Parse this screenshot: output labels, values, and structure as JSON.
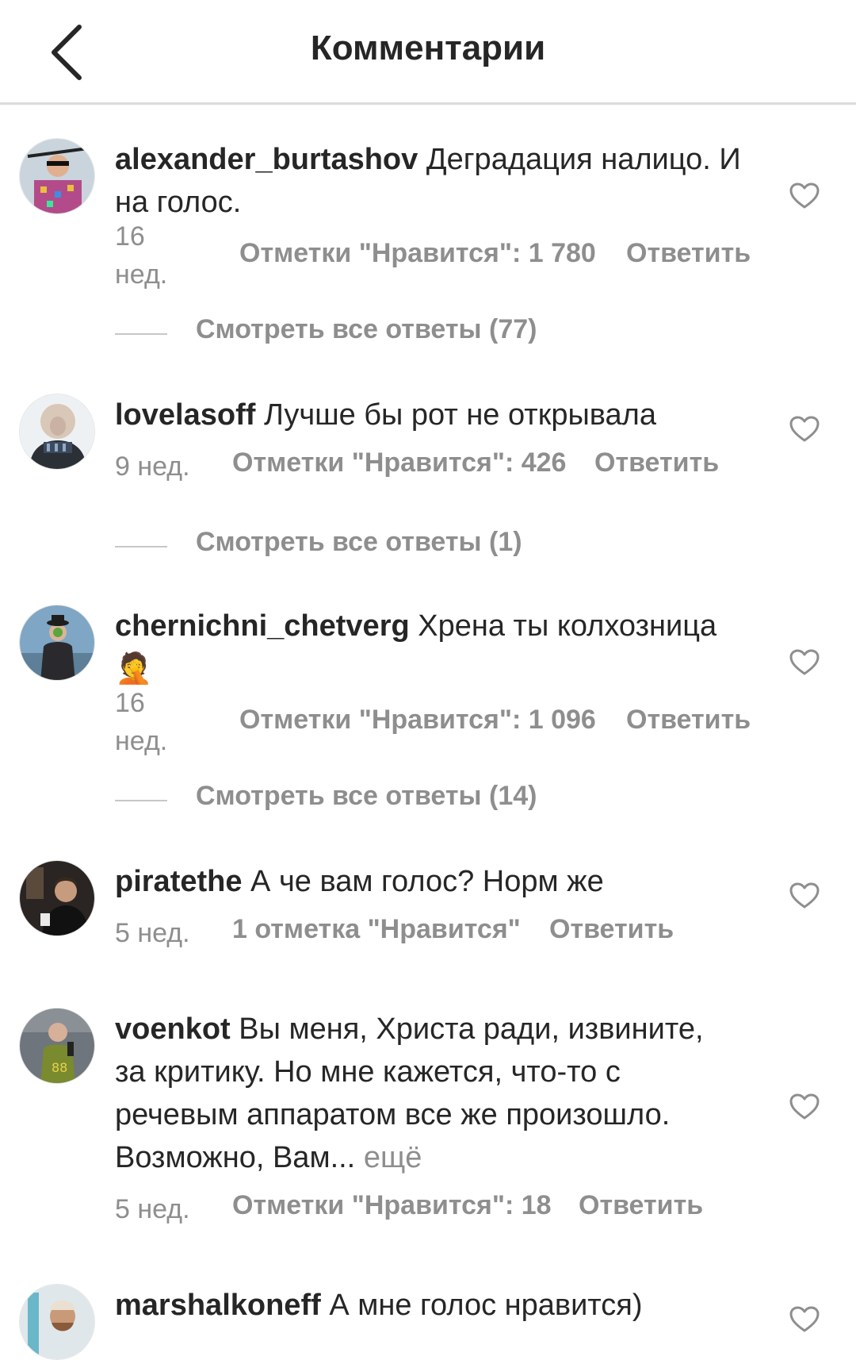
{
  "header": {
    "title": "Комментарии"
  },
  "comments": [
    {
      "username": "alexander_burtashov",
      "text": "Деградация налицо. И на голос.",
      "time": "16 нед.",
      "likes": "Отметки \"Нравится\": 1 780",
      "reply": "Ответить",
      "view_replies": "Смотреть все ответы (77)"
    },
    {
      "username": "lovelasoff",
      "text": "Лучше бы рот не открывала",
      "time": "9 нед.",
      "likes": "Отметки \"Нравится\": 426",
      "reply": "Ответить",
      "view_replies": "Смотреть все ответы (1)"
    },
    {
      "username": "chernichni_chetverg",
      "text": "Хрена ты колхозница",
      "emoji": "🤦",
      "time": "16 нед.",
      "likes": "Отметки \"Нравится\": 1 096",
      "reply": "Ответить",
      "view_replies": "Смотреть все ответы (14)"
    },
    {
      "username": "piratethe",
      "text": "А че вам голос? Норм же",
      "time": "5 нед.",
      "likes": "1 отметка \"Нравится\"",
      "reply": "Ответить"
    },
    {
      "username": "voenkot",
      "text": "Вы меня, Христа ради, извините, за критику. Но мне кажется, что-то с речевым аппаратом все же произошло. Возможно, Вам...",
      "more": "ещё",
      "time": "5 нед.",
      "likes": "Отметки \"Нравится\": 18",
      "reply": "Ответить"
    },
    {
      "username": "marshalkoneff",
      "text": "А мне голос нравится)"
    }
  ],
  "colors": {
    "text": "#262626",
    "secondary": "#8e8e8e",
    "divider": "#dbdbdb"
  },
  "icons": [
    "back-arrow-icon",
    "heart-icon"
  ]
}
